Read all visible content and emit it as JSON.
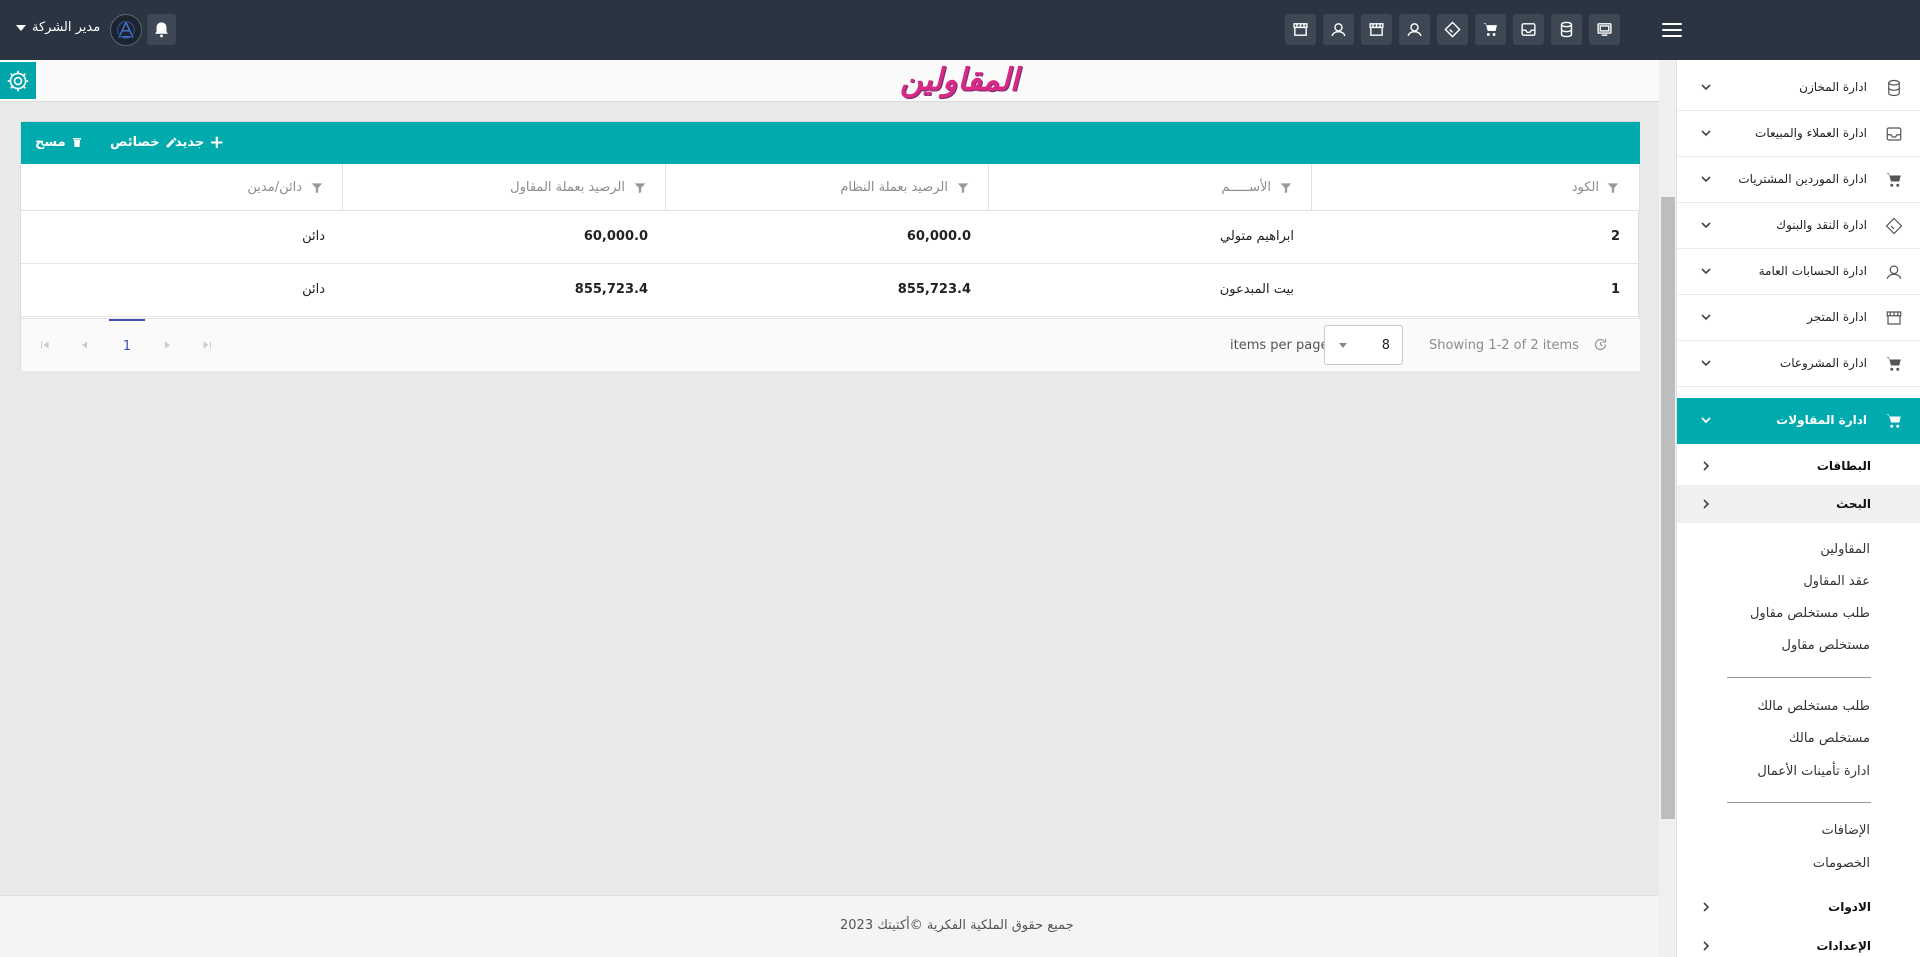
{
  "topbar": {
    "user_name": "مدير الشركة",
    "icons": [
      "store-icon",
      "user-icon",
      "store-icon",
      "user-icon",
      "tag-icon",
      "cart-icon",
      "inbox-icon",
      "database-icon",
      "monitor-icon"
    ]
  },
  "page": {
    "title": "المقاولين",
    "accent_color": "#00aaad",
    "title_color": "#d62a84"
  },
  "grid": {
    "toolbar": {
      "new_label": "جديد",
      "edit_label": "خصائص",
      "delete_label": "مسح"
    },
    "columns": [
      "الكود",
      "الأســـــم",
      "الرصيد بعملة النظام",
      "الرصيد بعملة المقاول",
      "دائن/مدين"
    ],
    "rows": [
      {
        "code": "2",
        "name": "ابراهيم متولي",
        "balance_system": "60,000.0",
        "balance_contractor": "60,000.0",
        "type": "دائن"
      },
      {
        "code": "1",
        "name": "بيت المبدعون",
        "balance_system": "855,723.4",
        "balance_contractor": "855,723.4",
        "type": "دائن"
      }
    ],
    "pager": {
      "showing": "Showing 1-2 of 2 items",
      "items_per_page_label": "items per page",
      "page_size": "8",
      "current_page": "1"
    }
  },
  "footer": {
    "text": "جميع حقوق الملكية الفكرية ©أكتيتك 2023"
  },
  "sidebar": {
    "items": [
      {
        "label": "ادارة المخازن",
        "icon": "database-icon"
      },
      {
        "label": "ادارة العملاء والمبيعات",
        "icon": "inbox-icon"
      },
      {
        "label": "ادارة الموردين المشتريات",
        "icon": "cart-icon"
      },
      {
        "label": "ادارة النقد والبنوك",
        "icon": "tag-icon"
      },
      {
        "label": "ادارة الحسابات العامة",
        "icon": "user-icon"
      },
      {
        "label": "ادارة المتجر",
        "icon": "store-icon"
      },
      {
        "label": "ادارة المشروعات",
        "icon": "cart-icon"
      },
      {
        "label": "ادارة المقاولات",
        "icon": "cart-icon"
      }
    ],
    "sub_sections": {
      "cards": "البطاقات",
      "search": "البحث",
      "tools": "الادوات",
      "settings": "الإعدادات"
    },
    "links_group1": [
      "المقاولين",
      "عقد المقاول",
      "طلب مستخلص مقاول",
      "مستخلص مقاول"
    ],
    "links_group2": [
      "طلب مستخلص مالك",
      "مستخلص مالك",
      "ادارة تأمينات الأعمال"
    ],
    "links_group3": [
      "الإضافات",
      "الخصومات"
    ]
  }
}
